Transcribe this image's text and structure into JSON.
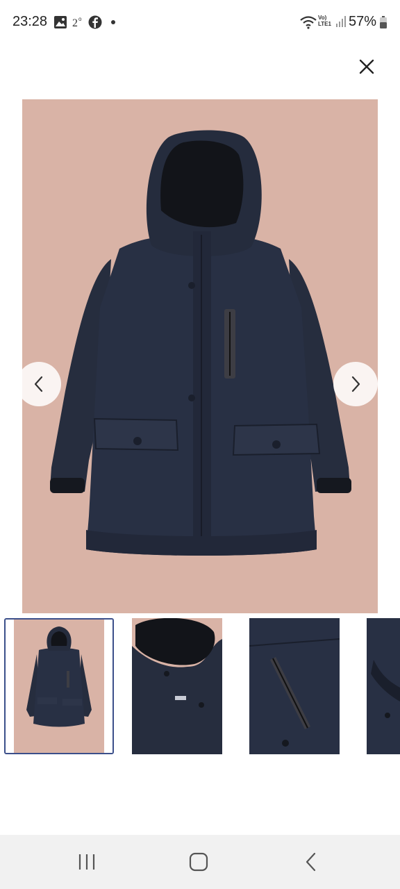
{
  "status_bar": {
    "time": "23:28",
    "battery": "57%",
    "network_line1": "Vo)",
    "network_line2": "LTE1",
    "icons": [
      "image-icon",
      "temperature-icon",
      "facebook-icon",
      "dot-icon",
      "wifi-icon",
      "signal-icon",
      "battery-icon"
    ]
  },
  "viewer": {
    "close_icon": "close-icon",
    "prev_icon": "chevron-left-icon",
    "next_icon": "chevron-right-icon",
    "background_color": "#d9b3a6",
    "jacket_color": "#252c3d"
  },
  "thumbnails": [
    {
      "name": "full-jacket",
      "selected": true
    },
    {
      "name": "hood-detail",
      "selected": false
    },
    {
      "name": "zip-pocket-detail",
      "selected": false
    },
    {
      "name": "cuff-detail",
      "selected": false
    }
  ],
  "nav_bar": {
    "icons": [
      "recent-apps-icon",
      "home-icon",
      "back-icon"
    ]
  }
}
